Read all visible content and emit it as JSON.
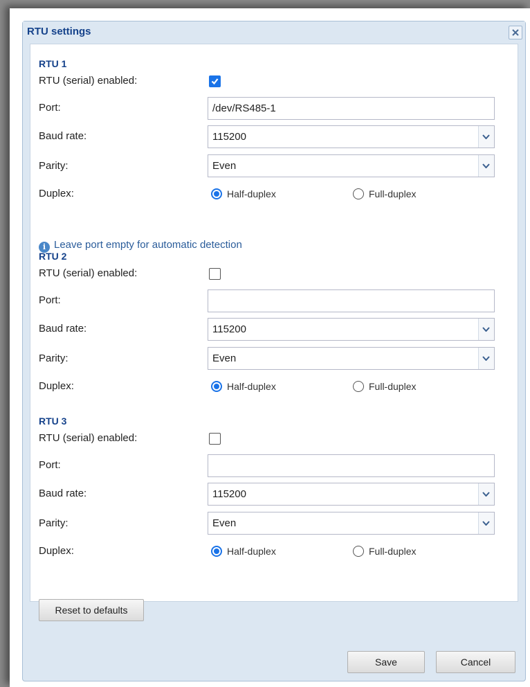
{
  "dialog": {
    "title": "RTU settings"
  },
  "sections": [
    {
      "title": "RTU 1",
      "enabled_label": "RTU (serial) enabled:",
      "enabled": true,
      "port_label": "Port:",
      "port_value": "/dev/RS485-1",
      "baud_label": "Baud rate:",
      "baud_value": "115200",
      "parity_label": "Parity:",
      "parity_value": "Even",
      "duplex_label": "Duplex:",
      "duplex_options": [
        "Half-duplex",
        "Full-duplex"
      ],
      "duplex_selected": "Half-duplex"
    },
    {
      "title": "RTU 2",
      "enabled_label": "RTU (serial) enabled:",
      "enabled": false,
      "port_label": "Port:",
      "port_value": "",
      "baud_label": "Baud rate:",
      "baud_value": "115200",
      "parity_label": "Parity:",
      "parity_value": "Even",
      "duplex_label": "Duplex:",
      "duplex_options": [
        "Half-duplex",
        "Full-duplex"
      ],
      "duplex_selected": "Half-duplex"
    },
    {
      "title": "RTU 3",
      "enabled_label": "RTU (serial) enabled:",
      "enabled": false,
      "port_label": "Port:",
      "port_value": "",
      "baud_label": "Baud rate:",
      "baud_value": "115200",
      "parity_label": "Parity:",
      "parity_value": "Even",
      "duplex_label": "Duplex:",
      "duplex_options": [
        "Half-duplex",
        "Full-duplex"
      ],
      "duplex_selected": "Half-duplex"
    }
  ],
  "info_text": "Leave port empty for automatic detection",
  "buttons": {
    "reset": "Reset to defaults",
    "save": "Save",
    "cancel": "Cancel"
  },
  "icons": {
    "close": "close-icon",
    "info": "info-icon",
    "dropdown": "chevron-down-icon",
    "check": "checkmark-icon"
  },
  "colors": {
    "accent": "#1a73e8",
    "title": "#15428b",
    "frame": "#dce7f2"
  }
}
